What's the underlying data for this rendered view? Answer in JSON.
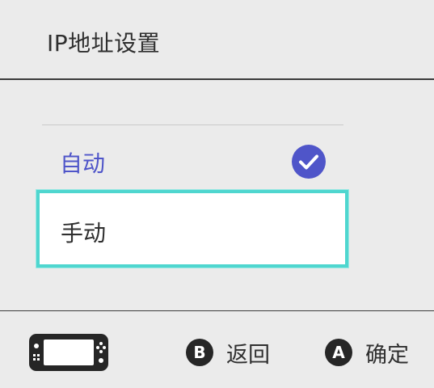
{
  "page": {
    "title": "IP地址设置"
  },
  "options": [
    {
      "label": "自动",
      "selected": true
    },
    {
      "label": "手动",
      "focused": true
    }
  ],
  "footer": {
    "back_button_letter": "B",
    "back_label": "返回",
    "confirm_button_letter": "A",
    "confirm_label": "确定"
  },
  "colors": {
    "background": "#ebebeb",
    "accent_blue": "#4f55c9",
    "focus_cyan": "#4fd6cf",
    "divider": "#3a3a3a"
  },
  "icons": {
    "selected": "check-circle-icon",
    "controller": "console-icon"
  }
}
